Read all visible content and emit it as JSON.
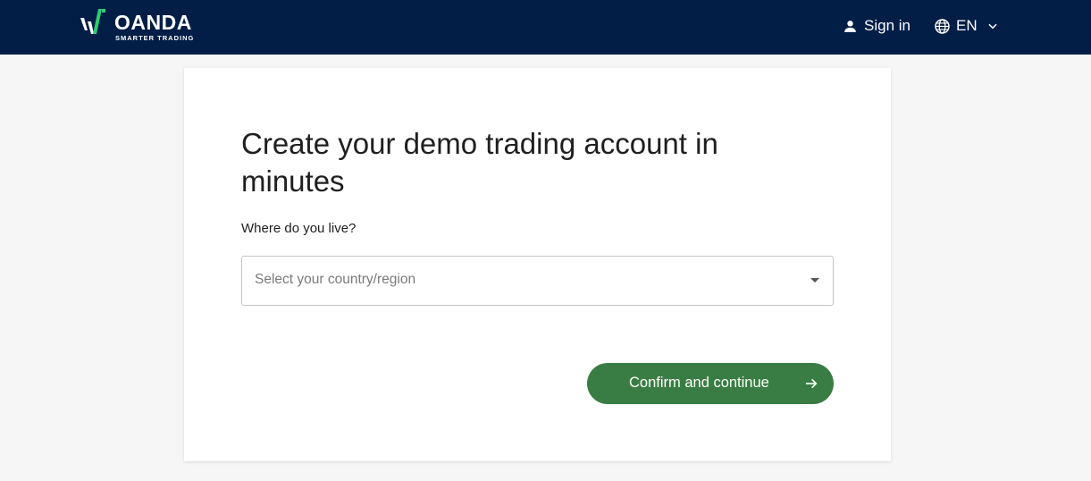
{
  "header": {
    "logo_word": "OANDA",
    "logo_tagline": "SMARTER TRADING",
    "sign_in_label": "Sign in",
    "language_label": "EN",
    "icons": {
      "user": "user-icon",
      "globe": "globe-icon",
      "chevron": "chevron-down-icon"
    },
    "colors": {
      "background": "#021e46",
      "logo_accent": "#2ecc71"
    }
  },
  "form": {
    "title": "Create your demo trading account in minutes",
    "question": "Where do you live?",
    "country_select": {
      "placeholder": "Select your country/region",
      "value": ""
    },
    "submit_label": "Confirm and continue",
    "submit_icon": "arrow-right-icon",
    "colors": {
      "button": "#3a7d44"
    }
  }
}
